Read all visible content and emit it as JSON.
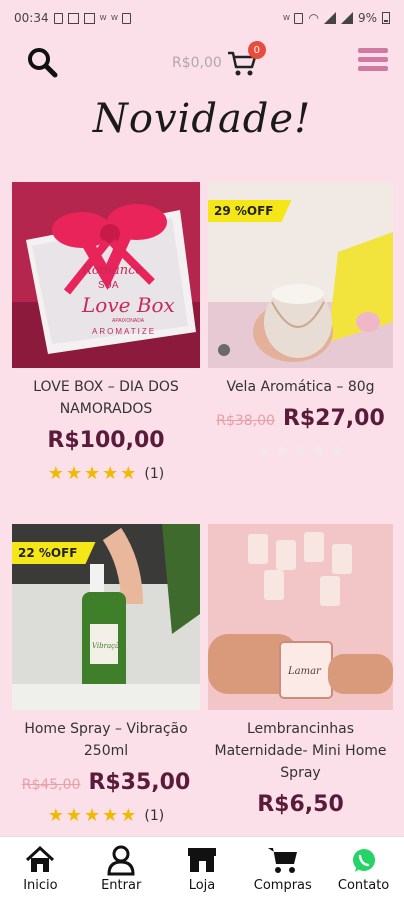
{
  "status": {
    "time": "00:34",
    "battery": "9%",
    "alerts": [
      "W",
      "W",
      "W"
    ]
  },
  "header": {
    "cart_total": "R$0,00",
    "cart_count": "0"
  },
  "page_title": "Novidade!",
  "products": [
    {
      "name": "LOVE BOX – DIA DOS NAMORADOS",
      "badge": "",
      "old_price": "",
      "price": "R$100,00",
      "stars": 5,
      "count": "(1)",
      "image_text": {
        "line1": "Romance",
        "line2": "SUA",
        "line3": "Love Box",
        "line4": "APAIXONADA",
        "line5": "AROMATIZE"
      }
    },
    {
      "name": "Vela Aromática – 80g",
      "badge": "29 %OFF",
      "old_price": "R$38,00",
      "price": "R$27,00",
      "stars": 0,
      "count": ""
    },
    {
      "name": "Home Spray – Vibração 250ml",
      "badge": "22 %OFF",
      "old_price": "R$45,00",
      "price": "R$35,00",
      "stars": 5,
      "count": "(1)",
      "image_text": {
        "label": "Vibração"
      }
    },
    {
      "name": "Lembrancinhas Maternidade- Mini Home Spray",
      "badge": "",
      "old_price": "",
      "price": "R$6,50",
      "stars": 0,
      "count": "",
      "image_text": {
        "label": "Lamar"
      }
    }
  ],
  "nav": [
    {
      "label": "Inicio",
      "icon": "home-icon"
    },
    {
      "label": "Entrar",
      "icon": "user-icon"
    },
    {
      "label": "Loja",
      "icon": "store-icon"
    },
    {
      "label": "Compras",
      "icon": "cart-icon"
    },
    {
      "label": "Contato",
      "icon": "whatsapp-icon"
    }
  ],
  "colors": {
    "background": "#fbe0ea",
    "price": "#5a1a3a",
    "badge": "#f5e617",
    "menu": "#d07aa3",
    "whatsapp": "#25d366"
  }
}
